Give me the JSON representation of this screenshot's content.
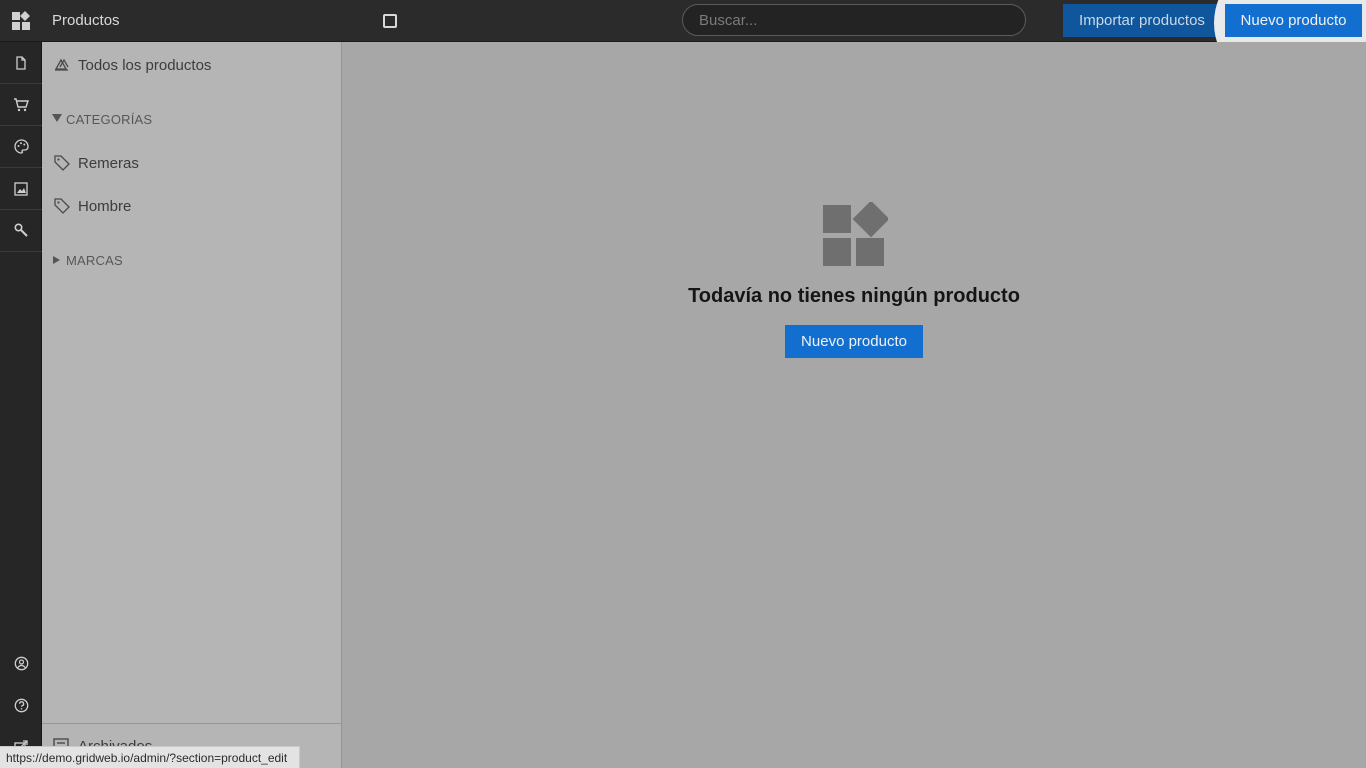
{
  "header": {
    "title": "Productos",
    "search_placeholder": "Buscar...",
    "import_label": "Importar productos",
    "new_label": "Nuevo producto"
  },
  "rail": {
    "items": [
      "logo-icon",
      "document-icon",
      "cart-icon",
      "palette-icon",
      "image-icon",
      "tools-icon",
      "account-icon",
      "help-icon",
      "exit-icon"
    ]
  },
  "sidebar": {
    "all_products": "Todos los productos",
    "categories_title": "CATEGORÍAS",
    "categories": [
      "Remeras",
      "Hombre"
    ],
    "brands_title": "MARCAS",
    "archived": "Archivados"
  },
  "main": {
    "empty_title": "Todavía no tienes ningún producto",
    "new_button": "Nuevo producto"
  },
  "status_url": "https://demo.gridweb.io/admin/?section=product_edit",
  "colors": {
    "accent": "#136fcf",
    "topbar": "#2b2b2b",
    "sidebar": "#b5b5b5",
    "main": "#a7a7a7"
  }
}
